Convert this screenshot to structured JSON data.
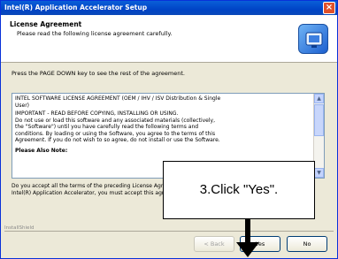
{
  "window": {
    "title": "Intel(R) Application Accelerator Setup",
    "close_glyph": "×"
  },
  "header": {
    "title": "License Agreement",
    "subtitle": "Please read the following license agreement carefully.",
    "icon": "setup-icon"
  },
  "instruction": "Press the PAGE DOWN key to see the rest of the agreement.",
  "license": {
    "lines": [
      "INTEL SOFTWARE LICENSE AGREEMENT (OEM / IHV / ISV Distribution & Single",
      "User)",
      "IMPORTANT - READ BEFORE COPYING, INSTALLING OR USING.",
      "Do not use or load this software and any associated materials (collectively,",
      "the \"Software\") until you have carefully read the following terms and",
      "conditions. By loading or using the Software, you agree to the terms of this",
      "Agreement. If you do not wish to so agree, do not install or use the Software."
    ],
    "heading": "Please Also Note:"
  },
  "accept_text": "Do you accept all the terms of the preceding License Agreement? If you choose No, the setup will close. To install Intel(R) Application Accelerator, you must accept this agreement.",
  "brand": "InstallShield",
  "buttons": {
    "back": "< Back",
    "yes": "Yes",
    "no": "No"
  },
  "callout": {
    "text": "3.Click \"Yes\"."
  },
  "colors": {
    "titlebar": "#0a5fd8",
    "dialog_background": "#ece9d8"
  }
}
